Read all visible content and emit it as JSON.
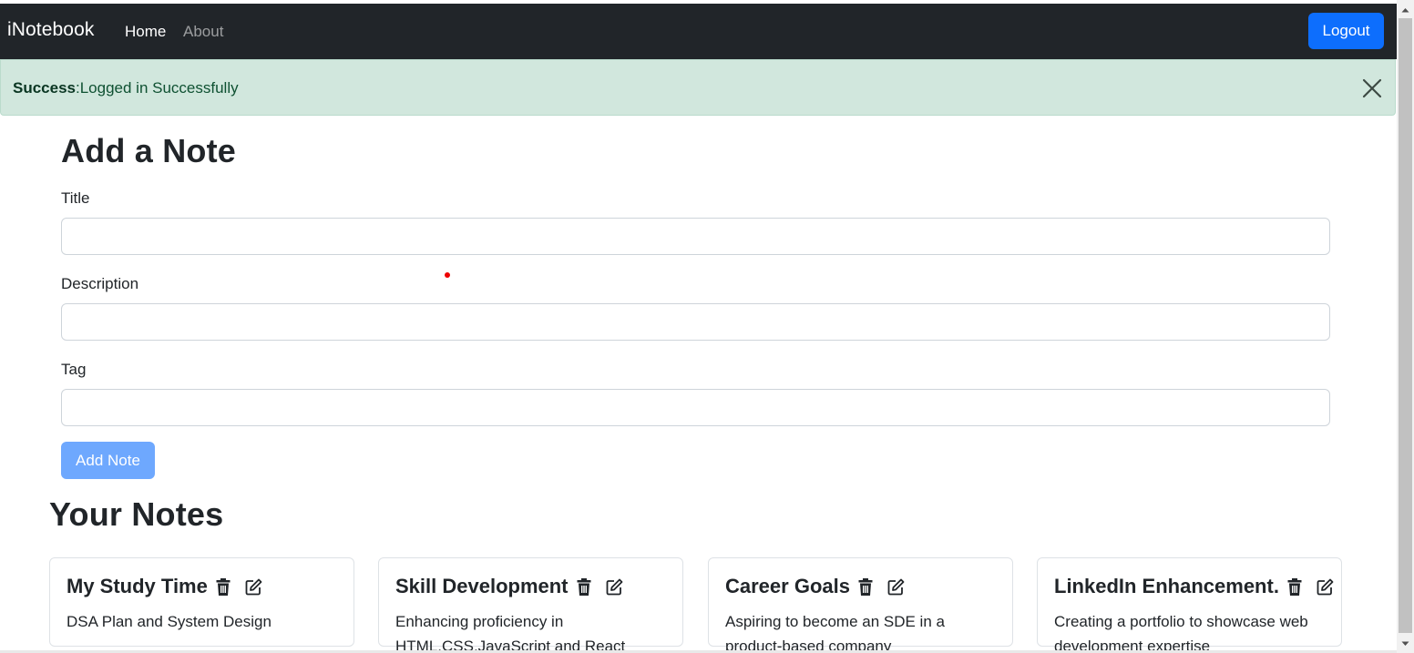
{
  "navbar": {
    "brand": "iNotebook",
    "links": [
      {
        "label": "Home"
      },
      {
        "label": "About"
      }
    ],
    "logout_label": "Logout"
  },
  "alert": {
    "strong": "Success",
    "message": ":Logged in Successfully"
  },
  "form": {
    "heading": "Add a Note",
    "title_label": "Title",
    "title_value": "",
    "description_label": "Description",
    "description_value": "",
    "tag_label": "Tag",
    "tag_value": "",
    "submit_label": "Add Note"
  },
  "notes": {
    "heading": "Your Notes",
    "items": [
      {
        "title": "My Study Time",
        "description": "DSA Plan and System Design"
      },
      {
        "title": "Skill Development",
        "description": "Enhancing proficiency in HTML,CSS,JavaScript and React"
      },
      {
        "title": "Career Goals",
        "description": "Aspiring to become an SDE in a product-based company"
      },
      {
        "title": "LinkedIn Enhancement.",
        "description": "Creating a portfolio to showcase web development expertise"
      }
    ]
  },
  "colors": {
    "navbar_bg": "#212529",
    "primary": "#0d6efd",
    "primary_disabled": "#6ea8fe",
    "alert_bg": "#d1e7dd",
    "alert_text": "#0f5132"
  },
  "icons": {
    "delete": "trash-icon",
    "edit": "edit-icon",
    "close": "close-icon"
  }
}
